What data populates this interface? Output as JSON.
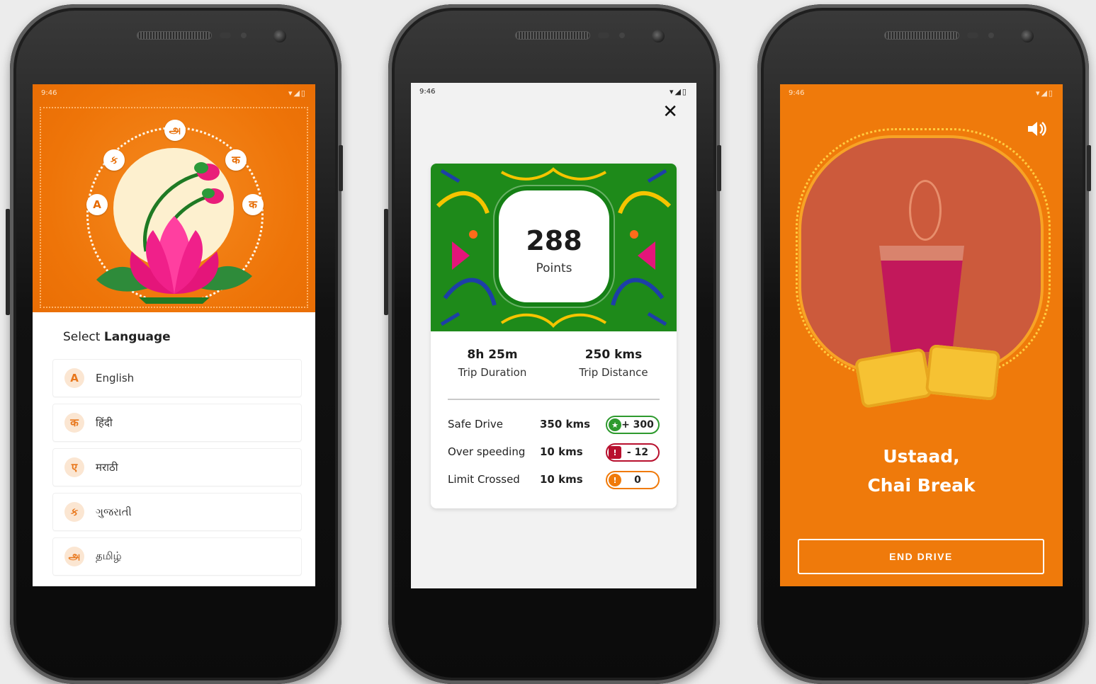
{
  "colors": {
    "orange": "#ef7a0b",
    "green": "#1e8a1a",
    "safe": "#2e9a2e",
    "warn": "#b8102e",
    "limit": "#f07a0a"
  },
  "phone1": {
    "status_time": "9:46",
    "status_icons": "▾◢▯",
    "header_glyphs": [
      "அ",
      "ક",
      "क",
      "A",
      "क"
    ],
    "title_prefix": "Select",
    "title_strong": "Language",
    "languages": [
      {
        "glyph": "A",
        "label": "English"
      },
      {
        "glyph": "क",
        "label": "हिंदी"
      },
      {
        "glyph": "ए",
        "label": "मराठी"
      },
      {
        "glyph": "ક",
        "label": "ગુજરાતી"
      },
      {
        "glyph": "அ",
        "label": "தமிழ்"
      }
    ]
  },
  "phone2": {
    "status_time": "9:46",
    "status_icons": "▾◢▯",
    "close_icon": "✕",
    "points_value": "288",
    "points_label": "Points",
    "stats": [
      {
        "value": "8h 25m",
        "label": "Trip Duration"
      },
      {
        "value": "250 kms",
        "label": "Trip Distance"
      }
    ],
    "rows": [
      {
        "name": "Safe Drive",
        "km": "350 kms",
        "icon": "★",
        "score": "+ 300",
        "kind": "safe"
      },
      {
        "name": "Over speeding",
        "km": "10 kms",
        "icon": "!",
        "score": "- 12",
        "kind": "warn"
      },
      {
        "name": "Limit Crossed",
        "km": "10 kms",
        "icon": "!",
        "score": "0",
        "kind": "limit"
      }
    ]
  },
  "phone3": {
    "status_time": "9:46",
    "status_icons": "▾◢▯",
    "title_line1": "Ustaad,",
    "title_line2": "Chai Break",
    "button_label": "END DRIVE"
  }
}
